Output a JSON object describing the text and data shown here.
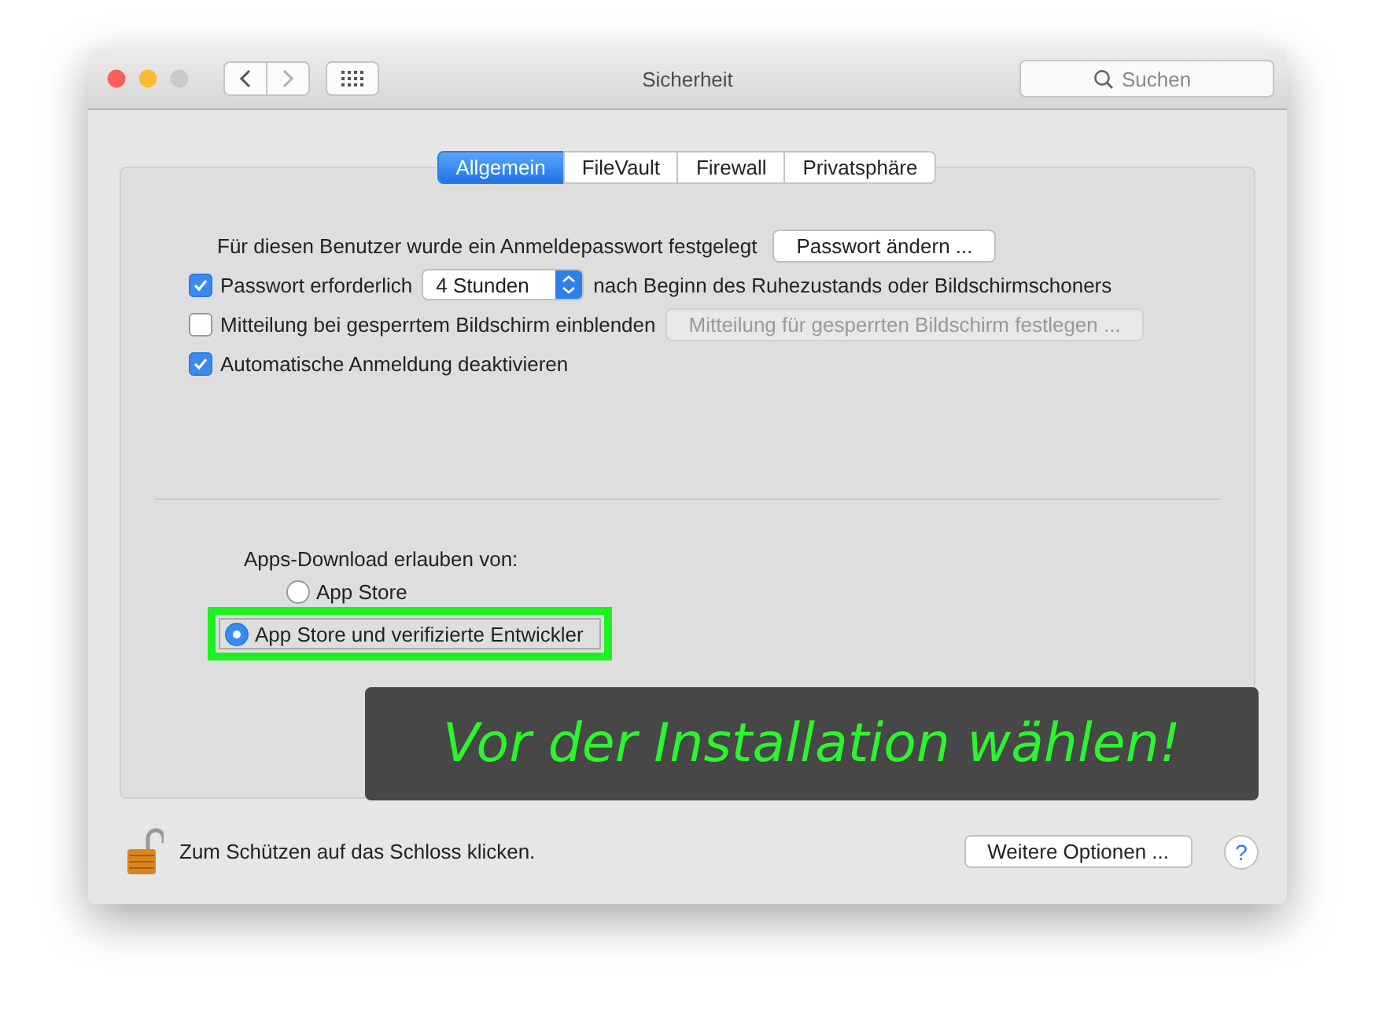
{
  "window": {
    "title": "Sicherheit",
    "search": {
      "placeholder": "Suchen"
    },
    "forward_disabled": true
  },
  "tabs": [
    {
      "label": "Allgemein",
      "selected": true
    },
    {
      "label": "FileVault",
      "selected": false
    },
    {
      "label": "Firewall",
      "selected": false
    },
    {
      "label": "Privatsphäre",
      "selected": false
    }
  ],
  "general": {
    "password_text": "Für diesen Benutzer wurde ein Anmeldepasswort festgelegt",
    "change_password_button": "Passwort ändern ...",
    "options": [
      {
        "kind": "select",
        "label": "Passwort erforderlich",
        "checked": true,
        "value": "4 Stunden",
        "suffix": "nach Beginn des Ruhezustands oder Bildschirmschoners"
      },
      {
        "kind": "button",
        "label": "Mitteilung bei gesperrtem Bildschirm einblenden",
        "checked": false,
        "button": "Mitteilung für gesperrten Bildschirm festlegen ...",
        "disabled": true
      },
      {
        "kind": "plain",
        "label": "Automatische Anmeldung deaktivieren",
        "checked": true
      }
    ]
  },
  "downloads": {
    "label": "Apps-Download erlauben von:",
    "options": [
      {
        "label": "App Store",
        "selected": false,
        "highlighted": false
      },
      {
        "label": "App Store und verifizierte Entwickler",
        "selected": true,
        "highlighted": true
      }
    ]
  },
  "annotation": {
    "text": "Vor der Installation wählen!"
  },
  "footer": {
    "lock_text": "Zum Schützen auf das Schloss klicken.",
    "more_button": "Weitere Optionen ...",
    "help": "?"
  }
}
